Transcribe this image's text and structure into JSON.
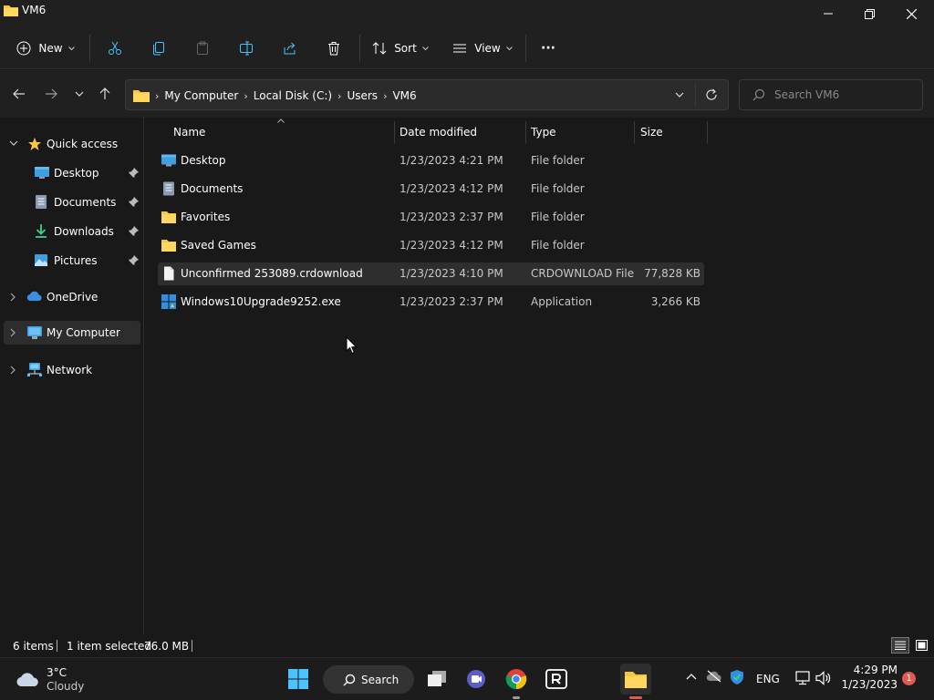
{
  "window": {
    "title": "VM6"
  },
  "toolbar": {
    "new_label": "New",
    "sort_label": "Sort",
    "view_label": "View",
    "more_label": "···"
  },
  "address": {
    "crumbs": [
      "My Computer",
      "Local Disk (C:)",
      "Users",
      "VM6"
    ]
  },
  "search": {
    "placeholder": "Search VM6"
  },
  "sidebar": {
    "items": [
      {
        "label": "Quick access",
        "icon": "star-icon"
      },
      {
        "label": "Desktop",
        "icon": "desktop-folder-icon",
        "pinned": true
      },
      {
        "label": "Documents",
        "icon": "documents-folder-icon",
        "pinned": true
      },
      {
        "label": "Downloads",
        "icon": "downloads-folder-icon",
        "pinned": true
      },
      {
        "label": "Pictures",
        "icon": "pictures-folder-icon",
        "pinned": true
      },
      {
        "label": "OneDrive",
        "icon": "cloud-icon"
      },
      {
        "label": "My Computer",
        "icon": "computer-icon",
        "selected": true
      },
      {
        "label": "Network",
        "icon": "network-icon"
      }
    ]
  },
  "columns": [
    "Name",
    "Date modified",
    "Type",
    "Size"
  ],
  "files": [
    {
      "name": "Desktop",
      "date": "1/23/2023 4:21 PM",
      "type": "File folder",
      "size": "",
      "icon": "desktop-folder-icon"
    },
    {
      "name": "Documents",
      "date": "1/23/2023 4:12 PM",
      "type": "File folder",
      "size": "",
      "icon": "documents-folder-icon"
    },
    {
      "name": "Favorites",
      "date": "1/23/2023 2:37 PM",
      "type": "File folder",
      "size": "",
      "icon": "folder-icon"
    },
    {
      "name": "Saved Games",
      "date": "1/23/2023 4:12 PM",
      "type": "File folder",
      "size": "",
      "icon": "folder-icon"
    },
    {
      "name": "Unconfirmed 253089.crdownload",
      "date": "1/23/2023 4:10 PM",
      "type": "CRDOWNLOAD File",
      "size": "77,828 KB",
      "icon": "file-icon",
      "selected": true
    },
    {
      "name": "Windows10Upgrade9252.exe",
      "date": "1/23/2023 2:37 PM",
      "type": "Application",
      "size": "3,266 KB",
      "icon": "windows-logo-icon"
    }
  ],
  "status": {
    "count": "6 items",
    "selection": "1 item selected",
    "selection_size": "76.0 MB"
  },
  "taskbar": {
    "weather_temp": "3°C",
    "weather_cond": "Cloudy",
    "search_label": "Search",
    "lang": "ENG",
    "time": "4:29 PM",
    "date": "1/23/2023",
    "notifications": "1"
  },
  "colors": {
    "accent": "#4cc2ff",
    "folder": "#f5c842",
    "notification": "#e05a4f"
  }
}
